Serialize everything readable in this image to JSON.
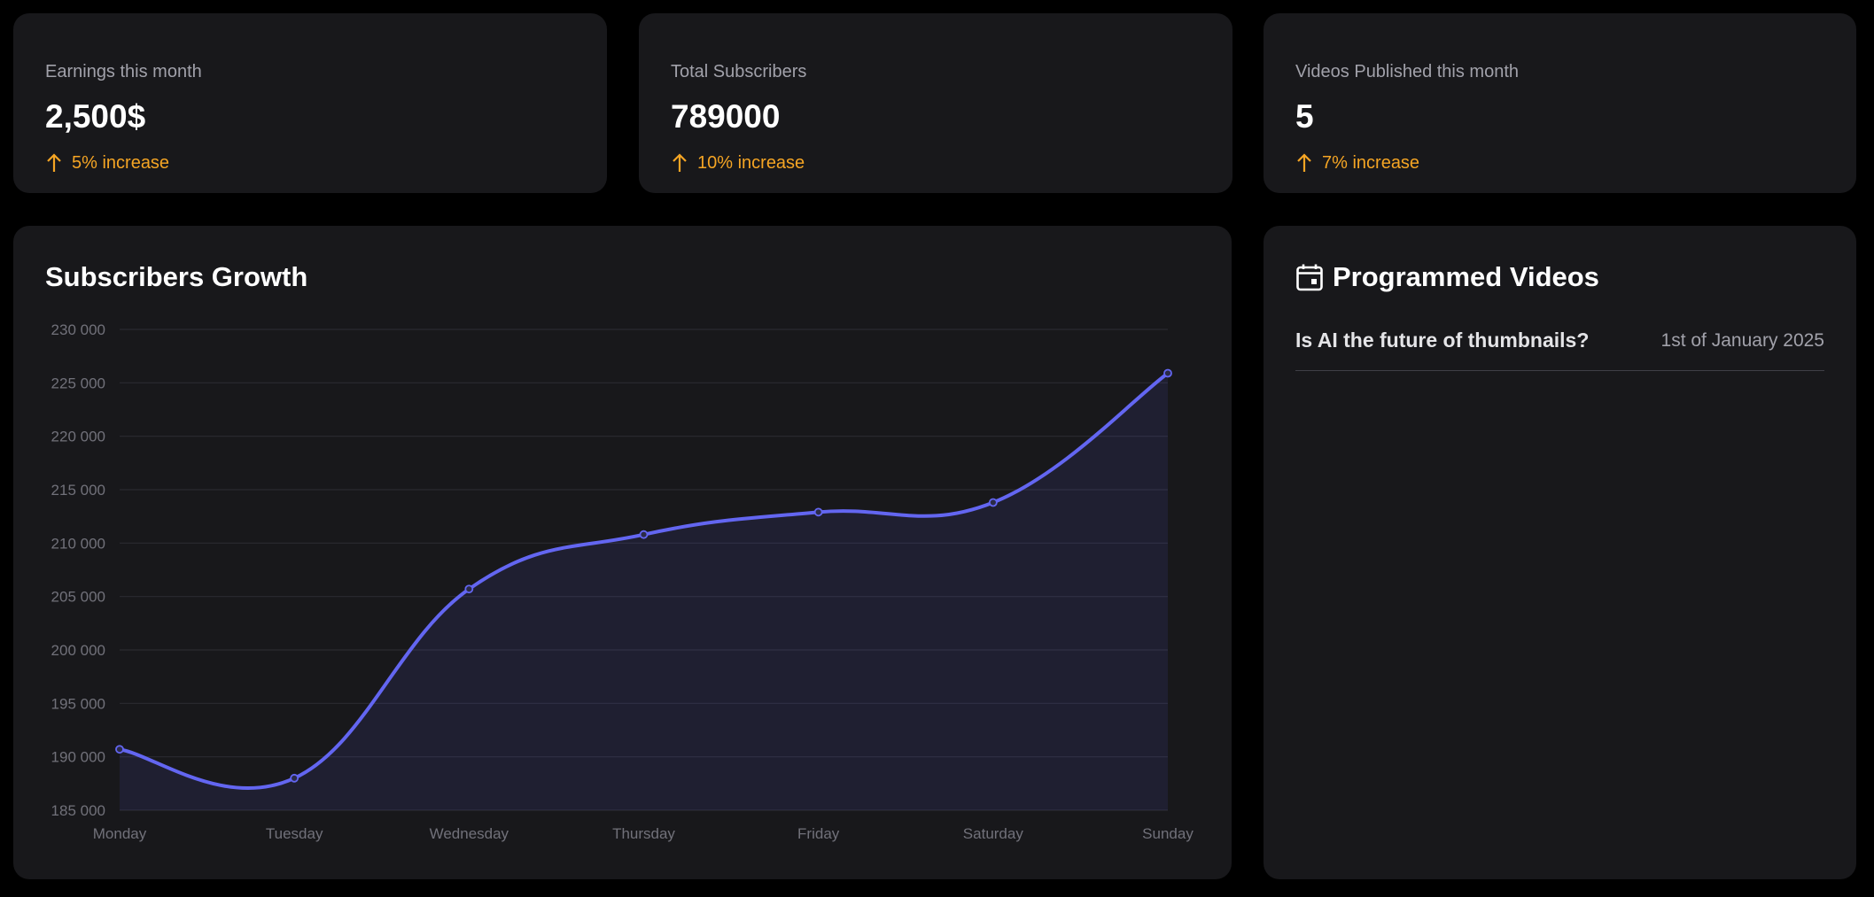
{
  "stats": [
    {
      "label": "Earnings this month",
      "value": "2,500$",
      "change": "5% increase"
    },
    {
      "label": "Total Subscribers",
      "value": "789000",
      "change": "10% increase"
    },
    {
      "label": "Videos Published this month",
      "value": "5",
      "change": "7% increase"
    }
  ],
  "colors": {
    "accent": "#6366f1",
    "increase": "#f5a524",
    "card": "#18181b",
    "background": "#000000"
  },
  "programmed_videos": {
    "title": "Programmed Videos",
    "icon": "calendar-icon",
    "items": [
      {
        "title": "Is AI the future of thumbnails?",
        "date": "1st of January 2025"
      }
    ]
  },
  "chart_data": {
    "type": "area",
    "title": "Subscribers Growth",
    "xlabel": "",
    "ylabel": "",
    "categories": [
      "Monday",
      "Tuesday",
      "Wednesday",
      "Thursday",
      "Friday",
      "Saturday",
      "Sunday"
    ],
    "series": [
      {
        "values": [
          190700,
          188000,
          205700,
          210800,
          212900,
          213800,
          225900
        ]
      }
    ],
    "y_ticks": [
      "230 000",
      "225 000",
      "220 000",
      "215 000",
      "210 000",
      "205 000",
      "200 000",
      "195 000",
      "190 000",
      "185 000"
    ],
    "ylim": [
      185000,
      230000
    ],
    "grid": true,
    "legend": "none"
  }
}
